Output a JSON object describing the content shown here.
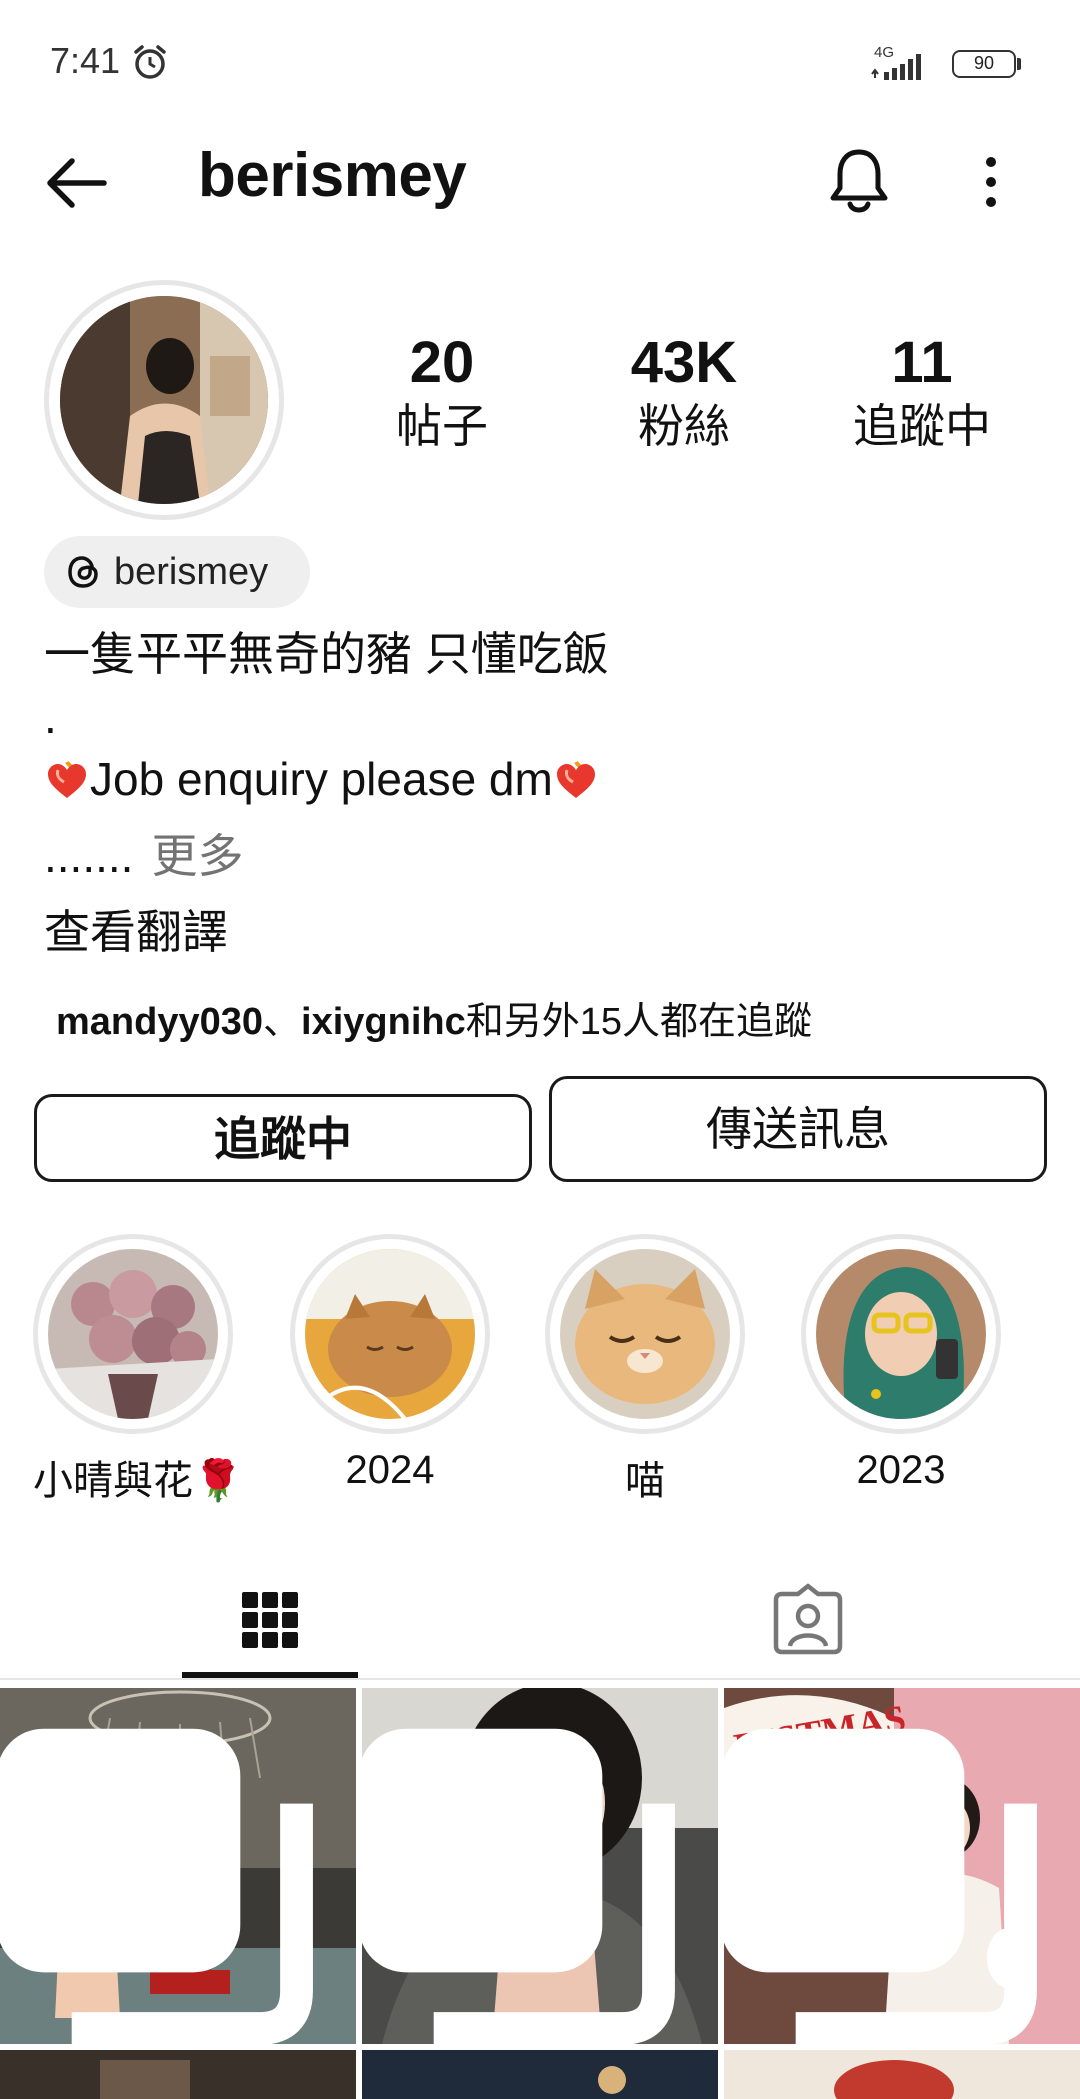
{
  "status_bar": {
    "time": "7:41",
    "network": "4G",
    "battery": "90"
  },
  "header": {
    "username": "berismey"
  },
  "stats": [
    {
      "value": "20",
      "label": "帖子"
    },
    {
      "value": "43K",
      "label": "粉絲"
    },
    {
      "value": "11",
      "label": "追蹤中"
    }
  ],
  "threads": {
    "handle": "berismey"
  },
  "bio": {
    "line1": "一隻平平無奇的豬 只懂吃飯",
    "line2": ".",
    "line3": "Job enquiry please dm",
    "line4": ".......",
    "more": "更多",
    "translate": "查看翻譯"
  },
  "followed_by": {
    "user1": "mandyy030",
    "sep": "、",
    "user2": "ixiygnihc",
    "rest": "和另外15人都在追蹤"
  },
  "buttons": {
    "following": "追蹤中",
    "message": "傳送訊息"
  },
  "highlights": [
    {
      "label": "小晴與花🌹"
    },
    {
      "label": "2024"
    },
    {
      "label": "喵"
    },
    {
      "label": "2023"
    }
  ],
  "icons": [
    "back-arrow-icon",
    "bell-icon",
    "more-vertical-icon",
    "threads-icon",
    "grid-icon",
    "tagged-icon",
    "alarm-icon",
    "signal-icon"
  ]
}
